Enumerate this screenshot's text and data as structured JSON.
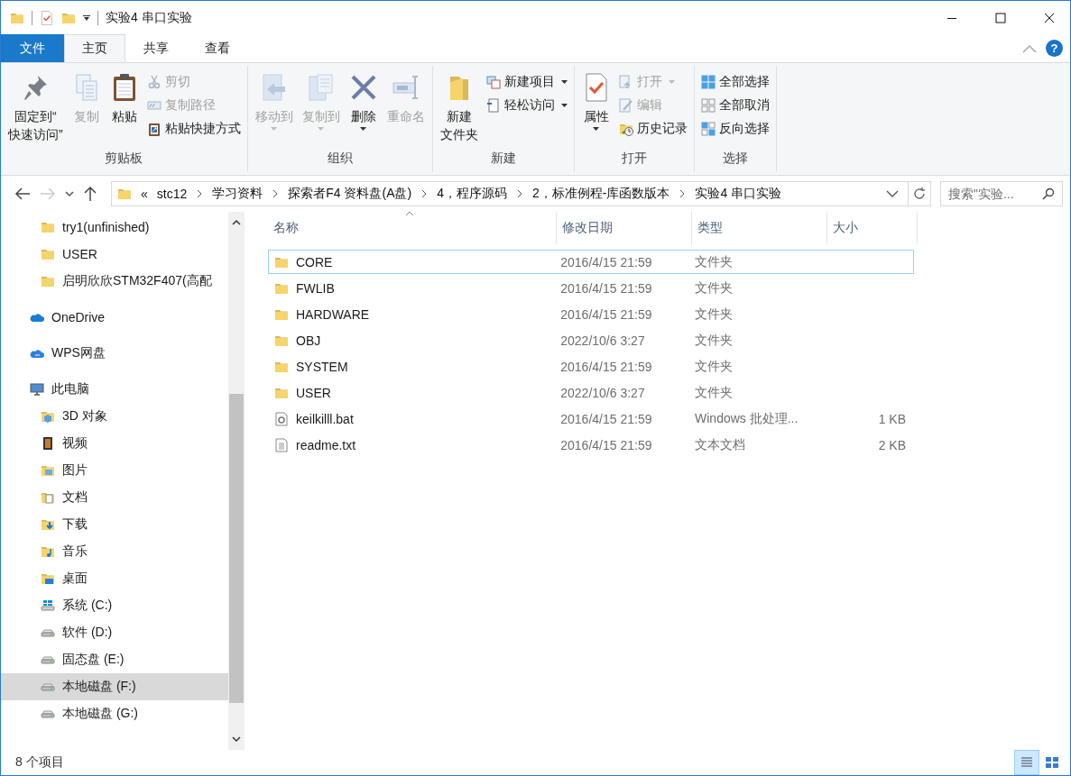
{
  "window": {
    "title": "实验4 串口实验"
  },
  "ribbon_tabs": [
    {
      "label": "文件",
      "kind": "file",
      "selected": false
    },
    {
      "label": "主页",
      "kind": "tab",
      "selected": true
    },
    {
      "label": "共享",
      "kind": "tab",
      "selected": false
    },
    {
      "label": "查看",
      "kind": "tab",
      "selected": false
    }
  ],
  "help": "?",
  "ribbon_groups": [
    {
      "label": "剪贴板",
      "large": [
        {
          "lines": [
            "固定到“",
            "快速访问”"
          ],
          "kind": "pin",
          "disabled": false,
          "dropdown": false
        },
        {
          "lines": [
            "复制"
          ],
          "kind": "copy",
          "disabled": true,
          "dropdown": false
        },
        {
          "lines": [
            "粘贴"
          ],
          "kind": "paste",
          "disabled": false,
          "dropdown": false
        }
      ],
      "small": [
        {
          "label": "剪切",
          "kind": "cut",
          "disabled": true,
          "dropdown": false
        },
        {
          "label": "复制路径",
          "kind": "copy-path",
          "disabled": true,
          "dropdown": false
        },
        {
          "label": "粘贴快捷方式",
          "kind": "paste-shortcut",
          "disabled": false,
          "dropdown": false
        }
      ]
    },
    {
      "label": "组织",
      "large": [
        {
          "lines": [
            "移动到"
          ],
          "kind": "move",
          "disabled": true,
          "dropdown": true
        },
        {
          "lines": [
            "复制到"
          ],
          "kind": "copy-to",
          "disabled": true,
          "dropdown": true
        },
        {
          "lines": [
            "删除"
          ],
          "kind": "delete",
          "disabled": false,
          "dropdown": true
        },
        {
          "lines": [
            "重命名"
          ],
          "kind": "rename",
          "disabled": true,
          "dropdown": false
        }
      ]
    },
    {
      "label": "新建",
      "large": [
        {
          "lines": [
            "新建",
            "文件夹"
          ],
          "kind": "new-folder",
          "disabled": false,
          "dropdown": false
        }
      ],
      "small": [
        {
          "label": "新建项目",
          "kind": "new-item",
          "disabled": false,
          "dropdown": true
        },
        {
          "label": "轻松访问",
          "kind": "easy-access",
          "disabled": false,
          "dropdown": true
        }
      ]
    },
    {
      "label": "打开",
      "large": [
        {
          "lines": [
            "属性"
          ],
          "kind": "properties",
          "disabled": false,
          "dropdown": true
        }
      ],
      "small": [
        {
          "label": "打开",
          "kind": "open",
          "disabled": true,
          "dropdown": true
        },
        {
          "label": "编辑",
          "kind": "edit",
          "disabled": true,
          "dropdown": false
        },
        {
          "label": "历史记录",
          "kind": "history",
          "disabled": false,
          "dropdown": false
        }
      ]
    },
    {
      "label": "选择",
      "small": [
        {
          "label": "全部选择",
          "kind": "select-all",
          "disabled": false,
          "dropdown": false
        },
        {
          "label": "全部取消",
          "kind": "select-none",
          "disabled": false,
          "dropdown": false
        },
        {
          "label": "反向选择",
          "kind": "invert",
          "disabled": false,
          "dropdown": false
        }
      ]
    }
  ],
  "nav": {
    "back_disabled": false,
    "forward_disabled": true
  },
  "address": {
    "prefix": "«",
    "crumbs": [
      "stc12",
      "学习资料",
      "探索者F4 资料盘(A盘)",
      "4，程序源码",
      "2，标准例程-库函数版本",
      "实验4 串口实验"
    ]
  },
  "search": {
    "placeholder": "搜索\"实验..."
  },
  "sidebar": {
    "items": [
      {
        "label": "try1(unfinished)",
        "kind": "folder",
        "selected": false,
        "top": false
      },
      {
        "label": "USER",
        "kind": "folder",
        "selected": false,
        "top": false
      },
      {
        "label": "启明欣欣STM32F407(高配",
        "kind": "folder",
        "selected": false,
        "top": false
      },
      {
        "label": "OneDrive",
        "kind": "cloud",
        "selected": false,
        "top": true
      },
      {
        "label": "WPS网盘",
        "kind": "wps-cloud",
        "selected": false,
        "top": true
      },
      {
        "label": "此电脑",
        "kind": "pc",
        "selected": false,
        "top": true,
        "children": [
          {
            "label": "3D 对象",
            "kind": "cube",
            "selected": false
          },
          {
            "label": "视频",
            "kind": "video",
            "selected": false
          },
          {
            "label": "图片",
            "kind": "picture",
            "selected": false
          },
          {
            "label": "文档",
            "kind": "document",
            "selected": false
          },
          {
            "label": "下载",
            "kind": "download",
            "selected": false
          },
          {
            "label": "音乐",
            "kind": "music",
            "selected": false
          },
          {
            "label": "桌面",
            "kind": "desktop",
            "selected": false
          },
          {
            "label": "系统 (C:)",
            "kind": "system-drive",
            "selected": false
          },
          {
            "label": "软件 (D:)",
            "kind": "drive",
            "selected": false
          },
          {
            "label": "固态盘 (E:)",
            "kind": "drive",
            "selected": false
          },
          {
            "label": "本地磁盘 (F:)",
            "kind": "drive",
            "selected": true
          },
          {
            "label": "本地磁盘 (G:)",
            "kind": "drive",
            "selected": false
          }
        ]
      }
    ]
  },
  "table": {
    "columns": [
      {
        "label": "名称",
        "sorted": true
      },
      {
        "label": "修改日期",
        "sorted": false
      },
      {
        "label": "类型",
        "sorted": false
      },
      {
        "label": "大小",
        "sorted": false
      }
    ],
    "rows": [
      {
        "name": "CORE",
        "date": "2016/4/15 21:59",
        "type": "文件夹",
        "kind": "folder",
        "focused": true
      },
      {
        "name": "FWLIB",
        "date": "2016/4/15 21:59",
        "type": "文件夹",
        "kind": "folder",
        "focused": false
      },
      {
        "name": "HARDWARE",
        "date": "2016/4/15 21:59",
        "type": "文件夹",
        "kind": "folder",
        "focused": false
      },
      {
        "name": "OBJ",
        "date": "2022/10/6 3:27",
        "type": "文件夹",
        "kind": "folder",
        "focused": false
      },
      {
        "name": "SYSTEM",
        "date": "2016/4/15 21:59",
        "type": "文件夹",
        "kind": "folder",
        "focused": false
      },
      {
        "name": "USER",
        "date": "2022/10/6 3:27",
        "type": "文件夹",
        "kind": "folder",
        "focused": false
      },
      {
        "name": "keilkilll.bat",
        "date": "2016/4/15 21:59",
        "type": "Windows 批处理...",
        "size": "1 KB",
        "kind": "bat",
        "focused": false
      },
      {
        "name": "readme.txt",
        "date": "2016/4/15 21:59",
        "type": "文本文档",
        "size": "2 KB",
        "kind": "txt",
        "focused": false
      }
    ]
  },
  "status_bar": {
    "count": "8 个项目",
    "views": [
      {
        "kind": "details",
        "selected": true
      },
      {
        "kind": "large-icons",
        "selected": false
      }
    ]
  }
}
